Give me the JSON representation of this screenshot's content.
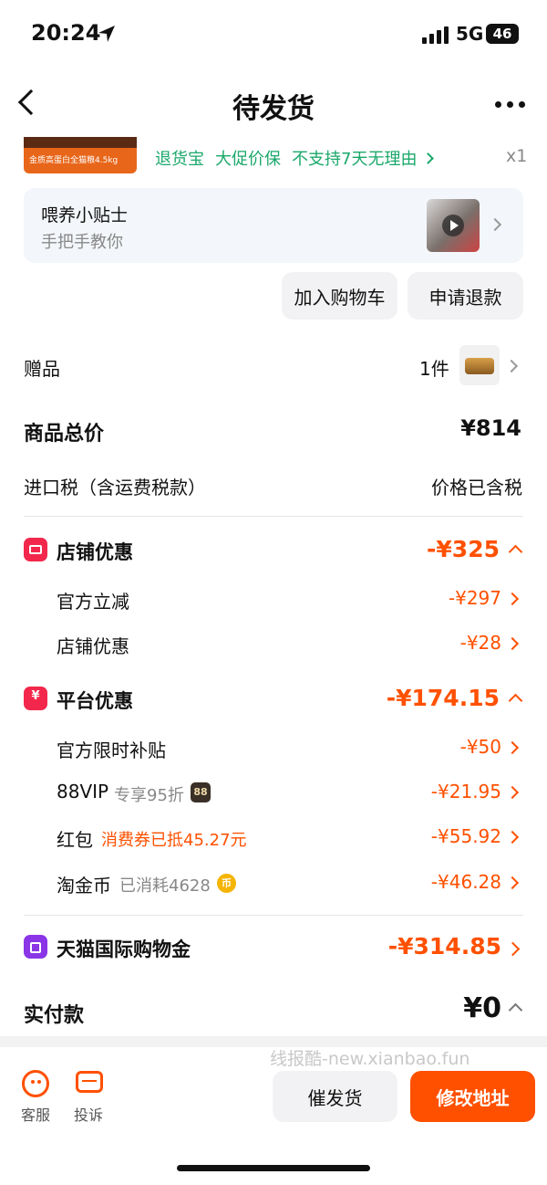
{
  "status_bar": {
    "time": "20:24",
    "network": "5G",
    "battery": "46"
  },
  "nav": {
    "title": "待发货"
  },
  "product": {
    "thumb_caption": "金质高蛋白全猫粮4.5kg",
    "services": [
      "退货宝",
      "大促价保",
      "不支持7天无理由"
    ],
    "quantity": "x1"
  },
  "tips": {
    "title": "喂养小贴士",
    "subtitle": "手把手教你"
  },
  "actions": {
    "add_cart": "加入购物车",
    "refund": "申请退款"
  },
  "gift": {
    "label": "赠品",
    "count": "1件"
  },
  "summary": {
    "total_label": "商品总价",
    "total_value": "¥814",
    "tax_label": "进口税（含运费税款）",
    "tax_value": "价格已含税"
  },
  "store_discount": {
    "title": "店铺优惠",
    "amount": "-¥325",
    "items": [
      {
        "label": "官方立减",
        "value": "-¥297"
      },
      {
        "label": "店铺优惠",
        "value": "-¥28"
      }
    ]
  },
  "platform_discount": {
    "title": "平台优惠",
    "amount": "-¥174.15",
    "items": [
      {
        "label": "官方限时补贴",
        "note": "",
        "value": "-¥50"
      },
      {
        "label": "88VIP",
        "note": "专享95折",
        "badge": "88",
        "value": "-¥21.95"
      },
      {
        "label": "红包",
        "note": "消费券已抵45.27元",
        "value": "-¥55.92"
      },
      {
        "label": "淘金币",
        "note": "已消耗4628",
        "badge": "币",
        "value": "-¥46.28"
      }
    ]
  },
  "tmall_gold": {
    "title": "天猫国际购物金",
    "amount": "-¥314.85"
  },
  "paid": {
    "label": "实付款",
    "value": "¥0"
  },
  "watermark": "线报酷-new.xianbao.fun",
  "bottom_bar": {
    "service": "客服",
    "complaint": "投诉",
    "urge": "催发货",
    "change_address": "修改地址"
  },
  "colors": {
    "accent": "#ff5000",
    "green": "#1aa86a",
    "store_icon": "#f2274b",
    "gold_icon": "#8a35e6"
  }
}
